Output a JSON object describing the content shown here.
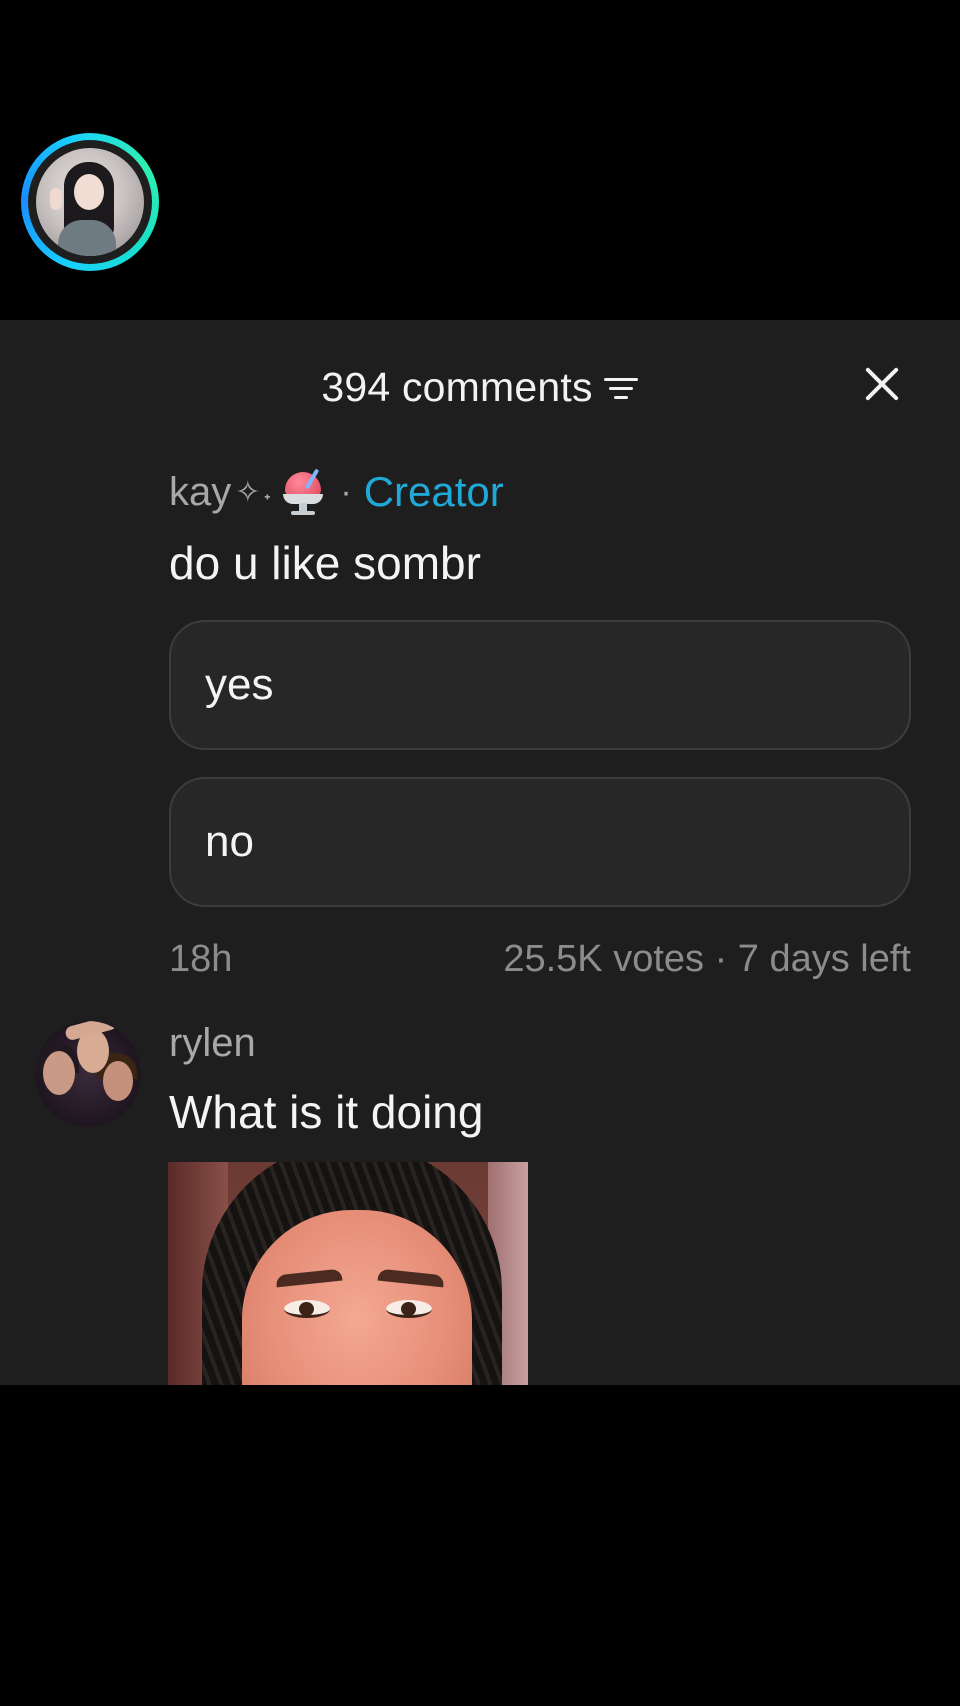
{
  "header": {
    "comments_count_label": "394 comments",
    "filter_icon": "filter-lines-icon",
    "close_icon": "close-x-icon"
  },
  "comments": [
    {
      "username": "kay",
      "username_decoration": "✧˖",
      "username_emoji": "shaved-ice-icon",
      "separator": "·",
      "badge": "Creator",
      "text": "do u like sombr",
      "poll": {
        "options": [
          "yes",
          "no"
        ],
        "votes_label": "25.5K votes · 7 days left"
      },
      "time": "18h"
    },
    {
      "username": "rylen",
      "text": "What is it doing",
      "has_image": true
    }
  ],
  "colors": {
    "sheet_bg": "#1e1e1e",
    "creator_accent": "#20a9d6",
    "ring_gradient_start": "#19d0ff",
    "ring_gradient_end": "#2ef0b0"
  }
}
